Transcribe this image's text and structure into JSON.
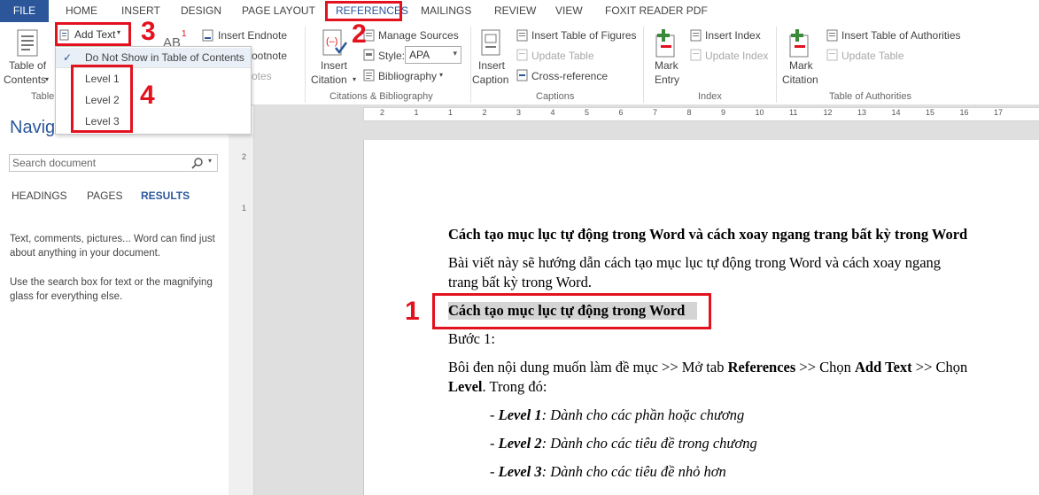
{
  "tabs": [
    "FILE",
    "HOME",
    "INSERT",
    "DESIGN",
    "PAGE LAYOUT",
    "REFERENCES",
    "MAILINGS",
    "REVIEW",
    "VIEW",
    "FOXIT READER PDF"
  ],
  "ribbon": {
    "toc": {
      "label1": "Table of",
      "label2": "Contents",
      "group_partial": "Table"
    },
    "add_text": "Add Text",
    "insert_endnote": "Insert Endnote",
    "footnote_partial": "ootnote",
    "notes_partial": "otes",
    "ab_label": "AB",
    "ab_sup": "1",
    "insert_citation": {
      "label1": "Insert",
      "label2": "Citation"
    },
    "manage_sources": "Manage Sources",
    "style_label": "Style:",
    "style_value": "APA",
    "bibliography": "Bibliography",
    "group_citations": "Citations & Bibliography",
    "insert_caption": {
      "label1": "Insert",
      "label2": "Caption"
    },
    "insert_table_of_figures": "Insert Table of Figures",
    "update_table": "Update Table",
    "cross_reference": "Cross-reference",
    "group_captions": "Captions",
    "mark_entry": {
      "label1": "Mark",
      "label2": "Entry"
    },
    "insert_index": "Insert Index",
    "update_index": "Update Index",
    "group_index": "Index",
    "mark_citation": {
      "label1": "Mark",
      "label2": "Citation"
    },
    "insert_table_of_authorities": "Insert Table of Authorities",
    "update_table_auth": "Update Table",
    "group_authorities": "Table of Authorities"
  },
  "dropdown": {
    "items": [
      "Do Not Show in Table of Contents",
      "Level 1",
      "Level 2",
      "Level 3"
    ]
  },
  "annotations": [
    "1",
    "2",
    "3",
    "4"
  ],
  "navigation": {
    "title_partial": "Navigation",
    "search_placeholder": "Search document",
    "tabs": [
      "HEADINGS",
      "PAGES",
      "RESULTS"
    ],
    "help1": "Text, comments, pictures... Word can find just about anything in your document.",
    "help2": "Use the search box for text or the magnifying glass for everything else."
  },
  "ruler": {
    "marks": [
      "2",
      "1",
      "1",
      "2",
      "3",
      "4",
      "5",
      "6",
      "7",
      "8",
      "9",
      "10",
      "11",
      "12",
      "13",
      "14",
      "15",
      "16",
      "17"
    ],
    "vmarks": [
      "2",
      "1"
    ]
  },
  "document": {
    "title": "Cách tạo mục lục tự động trong Word và cách xoay ngang trang bất kỳ trong Word",
    "intro_line1": "Bài viết này sẽ hướng dẫn cách tạo mục lục tự động trong Word và cách xoay ngang",
    "intro_line2": "trang bất kỳ trong Word.",
    "heading": "Cách tạo mục lục tự động trong Word",
    "step": "Bước 1:",
    "instr_a": "Bôi đen nội dung muốn làm đề mục >> Mở tab ",
    "instr_b": "References",
    "instr_c": " >> Chọn ",
    "instr_d": "Add Text",
    "instr_e": " >> Chọn",
    "instr2_a": "Level",
    "instr2_b": ". Trong đó:",
    "bullets": [
      {
        "dash": "- ",
        "level": "Level 1",
        "colon": ":",
        "desc": " Dành cho các phần hoặc chương"
      },
      {
        "dash": "- ",
        "level": "Level 2",
        "colon": ":",
        "desc": " Dành cho các tiêu đề trong chương"
      },
      {
        "dash": "- ",
        "level": "Level 3",
        "colon": ":",
        "desc": " Dành cho các tiêu đề nhỏ hơn"
      }
    ]
  },
  "colors": {
    "accent": "#2b579a",
    "annotation_red": "#e3121f",
    "highlight": "#d4d4d4"
  }
}
